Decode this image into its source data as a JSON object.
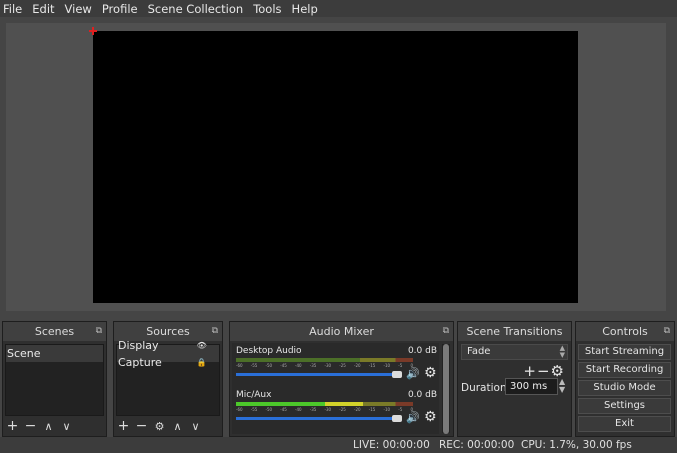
{
  "menu": [
    "File",
    "Edit",
    "View",
    "Profile",
    "Scene Collection",
    "Tools",
    "Help"
  ],
  "docks": {
    "scenes": {
      "title": "Scenes",
      "items": [
        "Scene"
      ]
    },
    "sources": {
      "title": "Sources",
      "items": [
        "Display Capture"
      ]
    },
    "mixer": {
      "title": "Audio Mixer",
      "channels": [
        {
          "name": "Desktop Audio",
          "db": "0.0 dB",
          "level": 0.0
        },
        {
          "name": "Mic/Aux",
          "db": "0.0 dB",
          "level": 0.72
        }
      ],
      "tick_labels": [
        "-60",
        "-55",
        "-50",
        "-45",
        "-40",
        "-35",
        "-30",
        "-25",
        "-20",
        "-15",
        "-10",
        "-5",
        "0"
      ]
    },
    "transitions": {
      "title": "Scene Transitions",
      "selected": "Fade",
      "duration_label": "Duration",
      "duration_value": "300 ms"
    },
    "controls": {
      "title": "Controls",
      "buttons": [
        "Start Streaming",
        "Start Recording",
        "Studio Mode",
        "Settings",
        "Exit"
      ]
    }
  },
  "icons": {
    "add": "+",
    "remove": "−",
    "up": "∧",
    "down": "∨",
    "gear": "⚙",
    "float": "⧉",
    "eye": "👁",
    "lock": "🔒",
    "volume": "🔊"
  },
  "status": {
    "live": "LIVE: 00:00:00",
    "rec": "REC: 00:00:00",
    "cpu": "CPU: 1.7%, 30.00 fps"
  }
}
